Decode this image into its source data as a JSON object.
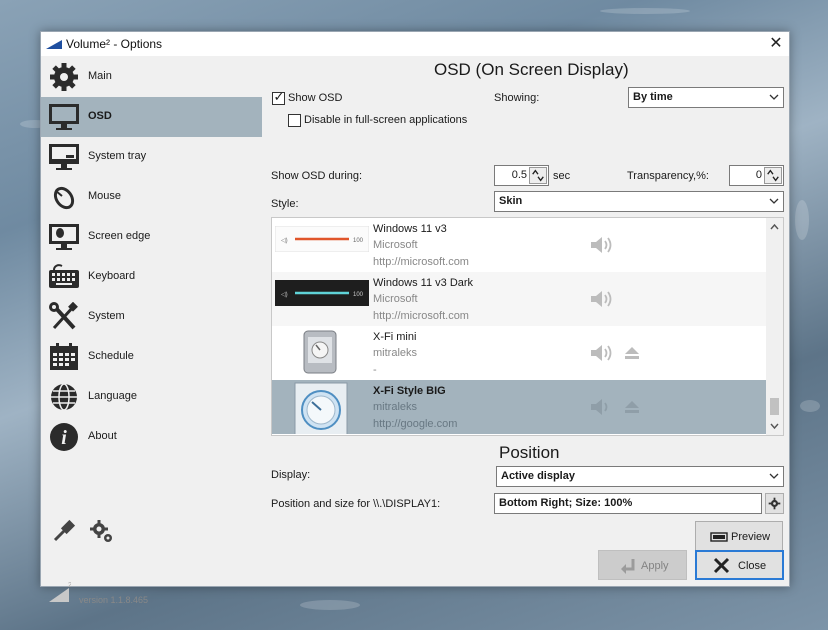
{
  "window": {
    "title": "Volume² - Options",
    "close_symbol": "✕"
  },
  "sidebar": {
    "items": [
      {
        "label": "Main",
        "icon": "gear-icon"
      },
      {
        "label": "OSD",
        "icon": "monitor-icon",
        "active": true
      },
      {
        "label": "System tray",
        "icon": "system-tray-icon"
      },
      {
        "label": "Mouse",
        "icon": "mouse-icon"
      },
      {
        "label": "Screen edge",
        "icon": "screen-edge-icon"
      },
      {
        "label": "Keyboard",
        "icon": "keyboard-icon"
      },
      {
        "label": "System",
        "icon": "wrench-screwdriver-icon"
      },
      {
        "label": "Schedule",
        "icon": "calendar-icon"
      },
      {
        "label": "Language",
        "icon": "globe-icon"
      },
      {
        "label": "About",
        "icon": "info-icon"
      }
    ],
    "version": "version 1.1.8.465"
  },
  "osd": {
    "title": "OSD (On Screen Display)",
    "show_osd_label": "Show OSD",
    "show_osd_checked": true,
    "disable_fullscreen_label": "Disable in full-screen applications",
    "disable_fullscreen_checked": false,
    "showing_label": "Showing:",
    "showing_value": "By time",
    "show_during_label": "Show OSD during:",
    "show_during_value": "0.5",
    "show_during_unit": "sec",
    "transparency_label": "Transparency,%:",
    "transparency_value": "0",
    "style_label": "Style:",
    "style_value": "Skin"
  },
  "skins": [
    {
      "name": "Windows 11 v3",
      "author": "Microsoft",
      "url": "http://microsoft.com",
      "thumb": "light-slider",
      "eject": false
    },
    {
      "name": "Windows 11 v3 Dark",
      "author": "Microsoft",
      "url": "http://microsoft.com",
      "thumb": "dark-slider",
      "eject": false
    },
    {
      "name": "X-Fi mini",
      "author": "mitraleks",
      "url": "-",
      "thumb": "xfi-mini",
      "eject": true
    },
    {
      "name": "X-Fi Style BIG",
      "author": "mitraleks",
      "url": "http://google.com",
      "thumb": "xfi-big",
      "eject": true,
      "selected": true
    }
  ],
  "position": {
    "title": "Position",
    "display_label": "Display:",
    "display_value": "Active display",
    "pos_size_label": "Position and size for \\\\.\\DISPLAY1:",
    "pos_size_value": "Bottom Right; Size: 100%",
    "preview_label": "Preview"
  },
  "footer": {
    "apply_label": "Apply",
    "close_label": "Close"
  },
  "colors": {
    "selection": "#a3b3bd",
    "panel": "#f0f0f0",
    "focus_border": "#2a7ad5",
    "slider_accent": "#e0552a",
    "slider_dark_accent": "#5fd3d8"
  }
}
